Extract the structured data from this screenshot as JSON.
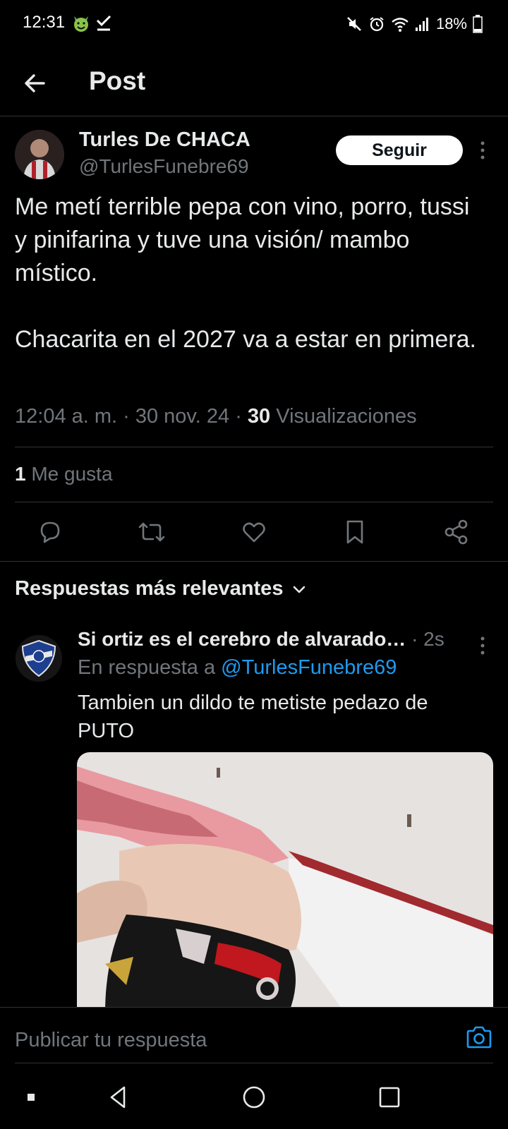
{
  "status_bar": {
    "time": "12:31",
    "battery": "18%"
  },
  "header": {
    "title": "Post"
  },
  "post": {
    "author_name": "Turles De CHACA",
    "author_handle": "@TurlesFunebre69",
    "follow_label": "Seguir",
    "text_line1": "Me metí terrible pepa con vino, porro, tussi y pinifarina y tuve una visión/ mambo místico.",
    "text_line2": "Chacarita en el 2027 va a estar en primera.",
    "timestamp": "12:04 a. m. · 30 nov. 24 · ",
    "views_count": "30",
    "views_label": " Visualizaciones",
    "likes_count": "1",
    "likes_label": " Me gusta"
  },
  "replies": {
    "sort_label": "Respuestas más relevantes",
    "items": [
      {
        "author_name": "Si ortiz es el cerebro de alvarado…",
        "time": " · 2s",
        "context_prefix": "En respuesta a ",
        "context_mention": "@TurlesFunebre69",
        "text": "Tambien un dildo te metiste pedazo de PUTO"
      }
    ]
  },
  "compose": {
    "placeholder": "Publicar tu respuesta"
  },
  "colors": {
    "background": "#000000",
    "text": "#e7e9ea",
    "muted": "#71767b",
    "accent": "#1d9bf0",
    "divider": "#2f3336"
  },
  "icons": {
    "back": "arrow-left-icon",
    "reply": "comment-icon",
    "repost": "repost-icon",
    "like": "heart-icon",
    "bookmark": "bookmark-icon",
    "share": "share-icon",
    "camera": "camera-icon"
  }
}
